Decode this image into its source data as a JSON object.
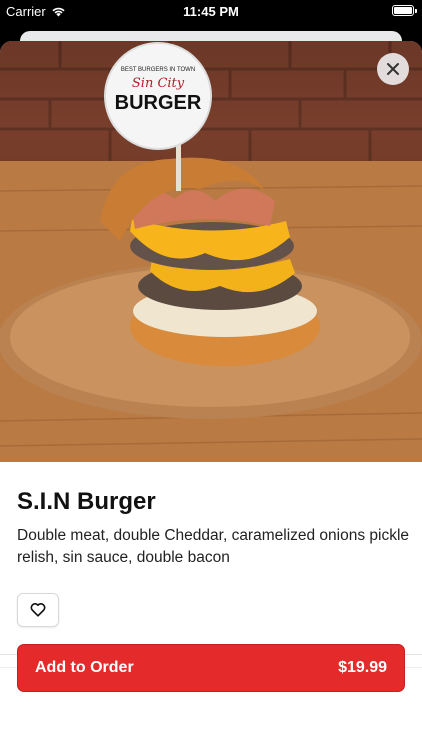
{
  "status_bar": {
    "carrier": "Carrier",
    "time": "11:45 PM"
  },
  "product": {
    "name": "S.I.N Burger",
    "description": "Double meat, double Cheddar, caramelized onions pickle relish, sin sauce, double bacon",
    "image_alt": "burger-photo"
  },
  "logo": {
    "top_text": "BEST BURGERS IN TOWN",
    "script_text": "Sin City",
    "main_text": "BURGER"
  },
  "actions": {
    "add_to_order_label": "Add to Order",
    "price": "$19.99"
  },
  "colors": {
    "accent": "#e42a2a",
    "text": "#111111"
  }
}
